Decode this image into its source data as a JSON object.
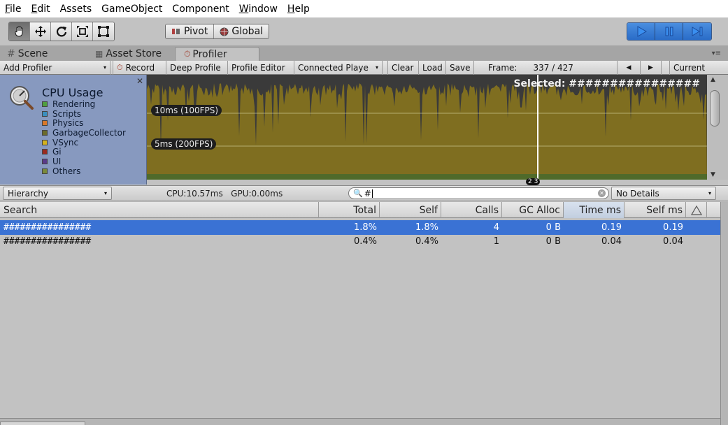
{
  "menu": {
    "items": [
      {
        "u": "F",
        "rest": "ile"
      },
      {
        "u": "E",
        "rest": "dit"
      },
      {
        "u": "",
        "rest": "Assets"
      },
      {
        "u": "",
        "rest": "GameObject"
      },
      {
        "u": "",
        "rest": "Component"
      },
      {
        "u": "W",
        "rest": "indow"
      },
      {
        "u": "H",
        "rest": "elp"
      }
    ]
  },
  "toolbar": {
    "tools": [
      "hand-icon",
      "move-icon",
      "rotate-icon",
      "scale-icon",
      "rect-icon"
    ],
    "pivot_label": "Pivot",
    "global_label": "Global",
    "play_icons": [
      "play-icon",
      "pause-icon",
      "step-icon"
    ]
  },
  "tabs": {
    "scene": "Scene",
    "asset_store": "Asset Store",
    "profiler": "Profiler"
  },
  "profiler_toolbar": {
    "add_profiler": "Add Profiler",
    "record": "Record",
    "deep_profile": "Deep Profile",
    "profile_editor": "Profile Editor",
    "connected_player": "Connected Playe",
    "clear": "Clear",
    "load": "Load",
    "save": "Save",
    "frame_label": "Frame:",
    "frame_value": "337 / 427",
    "current": "Current"
  },
  "cpu_panel": {
    "title": "CPU Usage",
    "legend": [
      {
        "label": "Rendering",
        "color": "#4f9f3f"
      },
      {
        "label": "Scripts",
        "color": "#3a8fbf"
      },
      {
        "label": "Physics",
        "color": "#d9782a"
      },
      {
        "label": "GarbageCollector",
        "color": "#6b6b2a"
      },
      {
        "label": "VSync",
        "color": "#d4b21e"
      },
      {
        "label": "Gi",
        "color": "#9a2a1e"
      },
      {
        "label": "UI",
        "color": "#5a3a8a"
      },
      {
        "label": "Others",
        "color": "#7a8a3a"
      }
    ],
    "fps_10": "10ms (100FPS)",
    "fps_5": "5ms (200FPS)",
    "selected": "Selected: ################",
    "marker": "2 3"
  },
  "hierarchy_toolbar": {
    "view": "Hierarchy",
    "cpu_gpu": "CPU:10.57ms   GPU:0.00ms",
    "search_value": "#",
    "details": "No Details"
  },
  "table": {
    "headers": [
      "Search",
      "Total",
      "Self",
      "Calls",
      "GC Alloc",
      "Time ms",
      "Self ms"
    ],
    "rows": [
      {
        "name": "################",
        "total": "1.8%",
        "self": "1.8%",
        "calls": "4",
        "gc": "0 B",
        "time": "0.19",
        "selfms": "0.19",
        "selected": true
      },
      {
        "name": "################",
        "total": "0.4%",
        "self": "0.4%",
        "calls": "1",
        "gc": "0 B",
        "time": "0.04",
        "selfms": "0.04",
        "selected": false
      }
    ]
  },
  "colors": {
    "graph_fill": "#7f6e20",
    "graph_bg": "#3a3a3a",
    "selection": "#3a72d4"
  }
}
